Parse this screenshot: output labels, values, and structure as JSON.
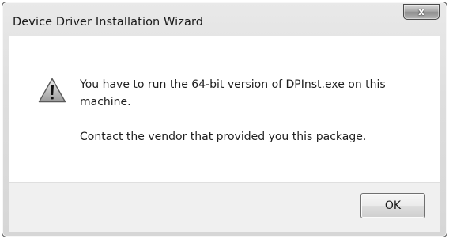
{
  "window": {
    "title": "Device Driver Installation Wizard",
    "close_glyph": "x",
    "close_icon": "close-icon"
  },
  "dialog": {
    "icon": "warning-icon",
    "message_line1": "You have to run the 64-bit version of DPInst.exe on this machine.",
    "message_line2": "Contact the vendor that provided you this package."
  },
  "buttons": {
    "ok_label": "OK"
  }
}
